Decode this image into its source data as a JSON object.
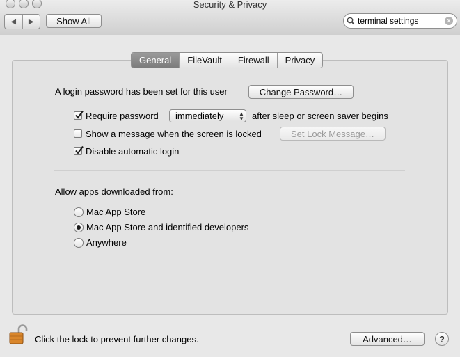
{
  "window": {
    "title": "Security & Privacy"
  },
  "toolbar": {
    "back_icon": "back-arrow-icon",
    "forward_icon": "forward-arrow-icon",
    "show_all_label": "Show All",
    "search": {
      "value": "terminal settings",
      "icon": "search-icon"
    }
  },
  "tabs": [
    {
      "label": "General",
      "selected": true
    },
    {
      "label": "FileVault",
      "selected": false
    },
    {
      "label": "Firewall",
      "selected": false
    },
    {
      "label": "Privacy",
      "selected": false
    }
  ],
  "general": {
    "login_text": "A login password has been set for this user",
    "change_password_label": "Change Password…",
    "require_password": {
      "label": "Require password",
      "checked": true
    },
    "require_select_value": "immediately",
    "after_text": "after sleep or screen saver begins",
    "show_message": {
      "label": "Show a message when the screen is locked",
      "checked": false
    },
    "set_lock_message_label": "Set Lock Message…",
    "disable_auto_login": {
      "label": "Disable automatic login",
      "checked": true
    }
  },
  "apps": {
    "heading": "Allow apps downloaded from:",
    "options": [
      {
        "label": "Mac App Store",
        "selected": false
      },
      {
        "label": "Mac App Store and identified developers",
        "selected": true
      },
      {
        "label": "Anywhere",
        "selected": false
      }
    ]
  },
  "footer": {
    "lock_text": "Click the lock to prevent further changes.",
    "advanced_label": "Advanced…",
    "help_label": "?"
  }
}
